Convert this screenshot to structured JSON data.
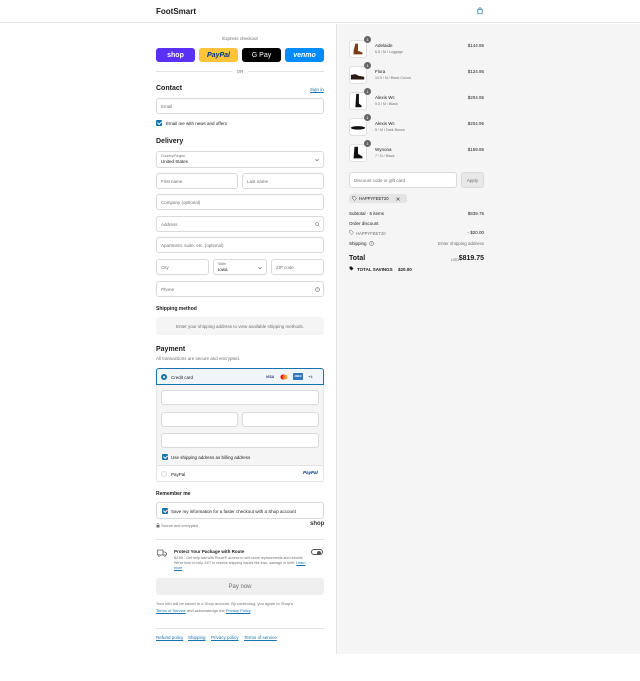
{
  "header": {
    "brand": "FootSmart",
    "cart_icon": "shopping-bag-icon"
  },
  "express": {
    "title": "Express checkout",
    "buttons": [
      {
        "label": "shop",
        "color": "#5a31f4"
      },
      {
        "label": "PayPal",
        "color": "#ffc439"
      },
      {
        "label": "G Pay",
        "color": "#000000"
      },
      {
        "label": "venmo",
        "color": "#008cff"
      }
    ],
    "or": "OR"
  },
  "contact": {
    "title": "Contact",
    "sign_in": "Sign in",
    "email_placeholder": "Email",
    "newsletter_label": "Email me with news and offers",
    "newsletter_checked": true
  },
  "delivery": {
    "title": "Delivery",
    "country_label": "Country/Region",
    "country_value": "United States",
    "first_name": "First name",
    "last_name": "Last name",
    "company": "Company (optional)",
    "address": "Address",
    "apartment": "Apartment, suite, etc. (optional)",
    "city": "City",
    "state_label": "State",
    "state_value": "Iowa",
    "zip": "ZIP code",
    "phone": "Phone"
  },
  "shipping_method": {
    "title": "Shipping method",
    "message": "Enter your shipping address to view available shipping methods."
  },
  "payment": {
    "title": "Payment",
    "subtitle": "All transactions are secure and encrypted.",
    "credit_card_label": "Credit card",
    "card_brands": [
      "VISA",
      "MC",
      "AMEX",
      "+4"
    ],
    "billing_label": "Use shipping address as billing address",
    "paypal_label": "PayPal",
    "paypal_logo": "PayPal"
  },
  "remember": {
    "title": "Remember me",
    "save_label": "Save my information for a faster checkout with a Shop account",
    "secure_label": "Secure and encrypted",
    "shop_logo": "shop"
  },
  "route": {
    "title": "Protect Your Package with Route",
    "desc": "$2.85 - Get help fast with Route® access to self-serve replacements and refunds. We're here to help 24/7 to resolve shipping issues like loss, damage or theft.",
    "learn_more": "Learn more"
  },
  "pay_now": "Pay now",
  "disclaimer": {
    "text1": "Your info will be saved to a Shop account. By continuing, you agree to Shop's",
    "terms": "Terms of Service",
    "text2": "and acknowledge the",
    "privacy": "Privacy Policy",
    "text3": "."
  },
  "footer_links": [
    "Refund policy",
    "Shipping",
    "Privacy policy",
    "Terms of service"
  ],
  "order": {
    "items": [
      {
        "name": "Adelaide",
        "variant": "6.5 / M / Luggage",
        "price": "$144.95",
        "qty": "1"
      },
      {
        "name": "Flora",
        "variant": "10.5 / N / Black Cocoa",
        "price": "$124.95",
        "qty": "1"
      },
      {
        "name": "Alexis Wc",
        "variant": "5.5 / M / Black",
        "price": "$204.95",
        "qty": "1"
      },
      {
        "name": "Alexis Wc",
        "variant": "5 / M / Dark Brown",
        "price": "$204.95",
        "qty": "1"
      },
      {
        "name": "Wynona",
        "variant": "7 / N / Black",
        "price": "$159.95",
        "qty": "1"
      }
    ],
    "discount_placeholder": "Discount code or gift card",
    "apply": "Apply",
    "code_chip": "HAPPYFEET20",
    "subtotal_label": "Subtotal · 5 items",
    "subtotal_value": "$839.75",
    "order_discount_label": "Order discount",
    "discount_code": "HAPPYFEET20",
    "discount_value": "- $20.00",
    "shipping_label": "Shipping",
    "shipping_value": "Enter shipping address",
    "total_label": "Total",
    "currency": "USD",
    "total_value": "$819.75",
    "savings_label": "TOTAL SAVINGS",
    "savings_value": "$20.00"
  }
}
